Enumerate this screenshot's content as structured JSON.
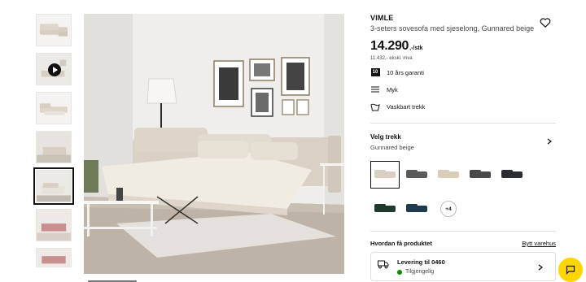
{
  "thumbnails": [
    {
      "kind": "product-side",
      "has_video": false
    },
    {
      "kind": "video-room",
      "has_video": true
    },
    {
      "kind": "open-bed",
      "has_video": false
    },
    {
      "kind": "room-wide",
      "has_video": false
    },
    {
      "kind": "room-bed-selected",
      "has_video": false
    },
    {
      "kind": "room-pink",
      "has_video": false
    },
    {
      "kind": "room-pink-2",
      "has_video": false
    }
  ],
  "product": {
    "name": "VIMLE",
    "description": "3-seters sovesofa med sjeselong, Gunnared beige",
    "price": "14.290",
    "price_unit": ",-/stk",
    "vat_text": "11.432,- ekskl. mva",
    "features": [
      {
        "icon": "warranty-10-icon",
        "badge": "10",
        "label": "10 års garanti"
      },
      {
        "icon": "softness-icon",
        "label": "Myk"
      },
      {
        "icon": "washable-icon",
        "label": "Vaskbart trekk"
      }
    ]
  },
  "cover": {
    "title": "Velg trekk",
    "selected": "Gunnared beige",
    "swatch_colors": [
      "#d6cfc2",
      "#5a5a5a",
      "#d8cdb9",
      "#4a4a4a",
      "#2b2d30",
      "#1f3a2c",
      "#1e3a4f"
    ],
    "more_label": "+4"
  },
  "delivery": {
    "heading": "Hvordan få produktet",
    "change_store": "Bytt varehus",
    "title": "Levering til 0460",
    "status": "Tilgjengelig",
    "status_color": "#0a8a00"
  },
  "colors": {
    "accent_yellow": "#ffd500",
    "text": "#111111"
  }
}
